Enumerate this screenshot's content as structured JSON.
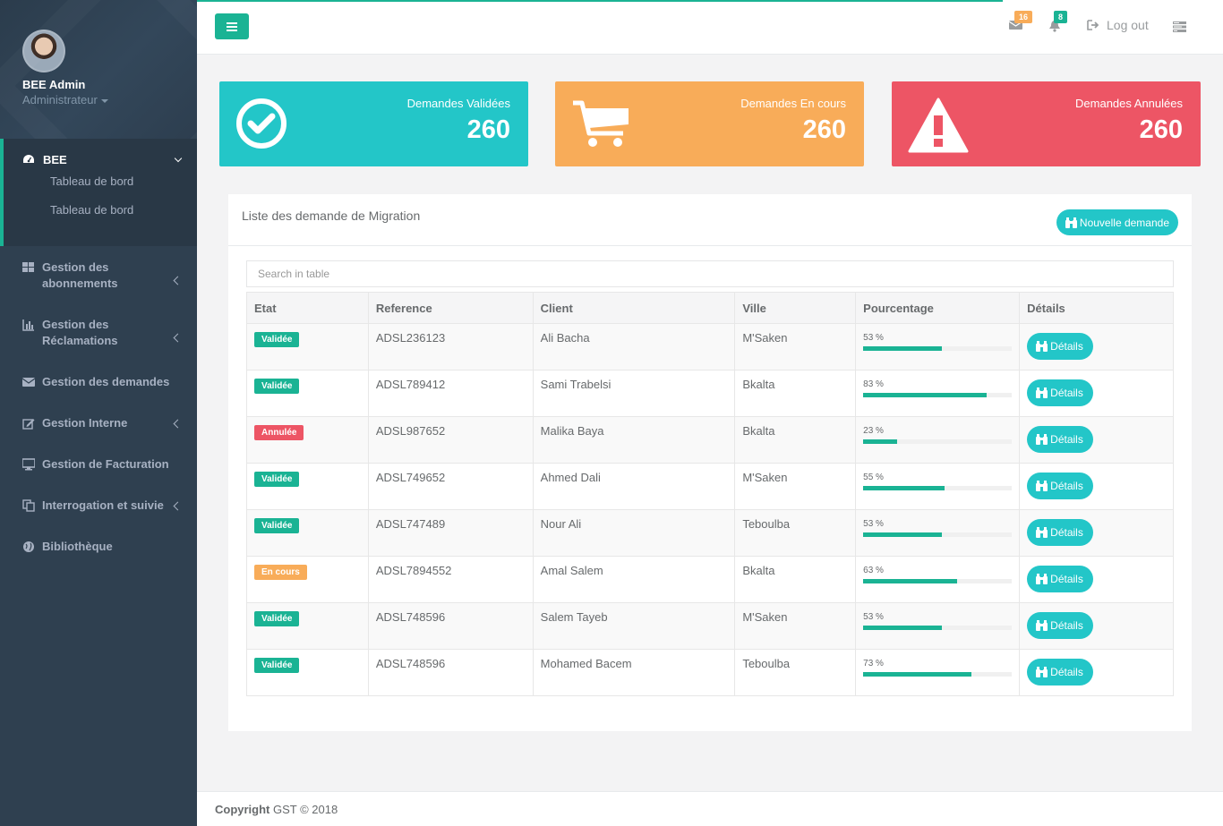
{
  "profile": {
    "name": "BEE Admin",
    "role": "Administrateur"
  },
  "sidebar": {
    "active": {
      "label": "BEE",
      "sub": [
        "Tableau de bord",
        "Tableau de bord"
      ]
    },
    "items": [
      {
        "label": "Gestion des abonnements",
        "icon": "th-large-icon",
        "chevron": true
      },
      {
        "label": "Gestion des Réclamations",
        "icon": "bar-chart-icon",
        "chevron": true
      },
      {
        "label": "Gestion des demandes",
        "icon": "envelope-icon",
        "chevron": false
      },
      {
        "label": "Gestion Interne",
        "icon": "edit-icon",
        "chevron": true
      },
      {
        "label": "Gestion de Facturation",
        "icon": "desktop-icon",
        "chevron": false
      },
      {
        "label": "Interrogation et suivie",
        "icon": "files-icon",
        "chevron": true
      },
      {
        "label": "Bibliothèque",
        "icon": "globe-icon",
        "chevron": false
      }
    ]
  },
  "topbar": {
    "mail_count": "16",
    "bell_count": "8",
    "logout_label": "Log out"
  },
  "stats": [
    {
      "label": "Demandes Validées",
      "value": "260",
      "color": "#23c6c8",
      "icon": "check-circle-icon"
    },
    {
      "label": "Demandes En cours",
      "value": "260",
      "color": "#f8ac59",
      "icon": "shopping-cart-icon"
    },
    {
      "label": "Demandes Annulées",
      "value": "260",
      "color": "#ed5565",
      "icon": "warning-icon"
    }
  ],
  "panel": {
    "title": "Liste des demande de Migration",
    "new_button": "Nouvelle demande",
    "search_placeholder": "Search in table"
  },
  "table": {
    "headers": [
      "Etat",
      "Reference",
      "Client",
      "Ville",
      "Pourcentage",
      "Détails"
    ],
    "details_label": "Détails",
    "rows": [
      {
        "etat": "Validée",
        "etat_color": "#1ab394",
        "ref": "ADSL236123",
        "client": "Ali Bacha",
        "ville": "M'Saken",
        "pct": 53,
        "pct_text": "53 %"
      },
      {
        "etat": "Validée",
        "etat_color": "#1ab394",
        "ref": "ADSL789412",
        "client": "Sami Trabelsi",
        "ville": "Bkalta",
        "pct": 83,
        "pct_text": "83 %"
      },
      {
        "etat": "Annulée",
        "etat_color": "#ed5565",
        "ref": "ADSL987652",
        "client": "Malika Baya",
        "ville": "Bkalta",
        "pct": 23,
        "pct_text": "23 %"
      },
      {
        "etat": "Validée",
        "etat_color": "#1ab394",
        "ref": "ADSL749652",
        "client": "Ahmed Dali",
        "ville": "M'Saken",
        "pct": 55,
        "pct_text": "55 %"
      },
      {
        "etat": "Validée",
        "etat_color": "#1ab394",
        "ref": "ADSL747489",
        "client": "Nour Ali",
        "ville": "Teboulba",
        "pct": 53,
        "pct_text": "53 %"
      },
      {
        "etat": "En cours",
        "etat_color": "#f8ac59",
        "ref": "ADSL7894552",
        "client": "Amal Salem",
        "ville": "Bkalta",
        "pct": 63,
        "pct_text": "63 %"
      },
      {
        "etat": "Validée",
        "etat_color": "#1ab394",
        "ref": "ADSL748596",
        "client": "Salem Tayeb",
        "ville": "M'Saken",
        "pct": 53,
        "pct_text": "53 %"
      },
      {
        "etat": "Validée",
        "etat_color": "#1ab394",
        "ref": "ADSL748596",
        "client": "Mohamed Bacem",
        "ville": "Teboulba",
        "pct": 73,
        "pct_text": "73 %"
      }
    ]
  },
  "footer": {
    "bold": "Copyright",
    "rest": "GST © 2018"
  }
}
